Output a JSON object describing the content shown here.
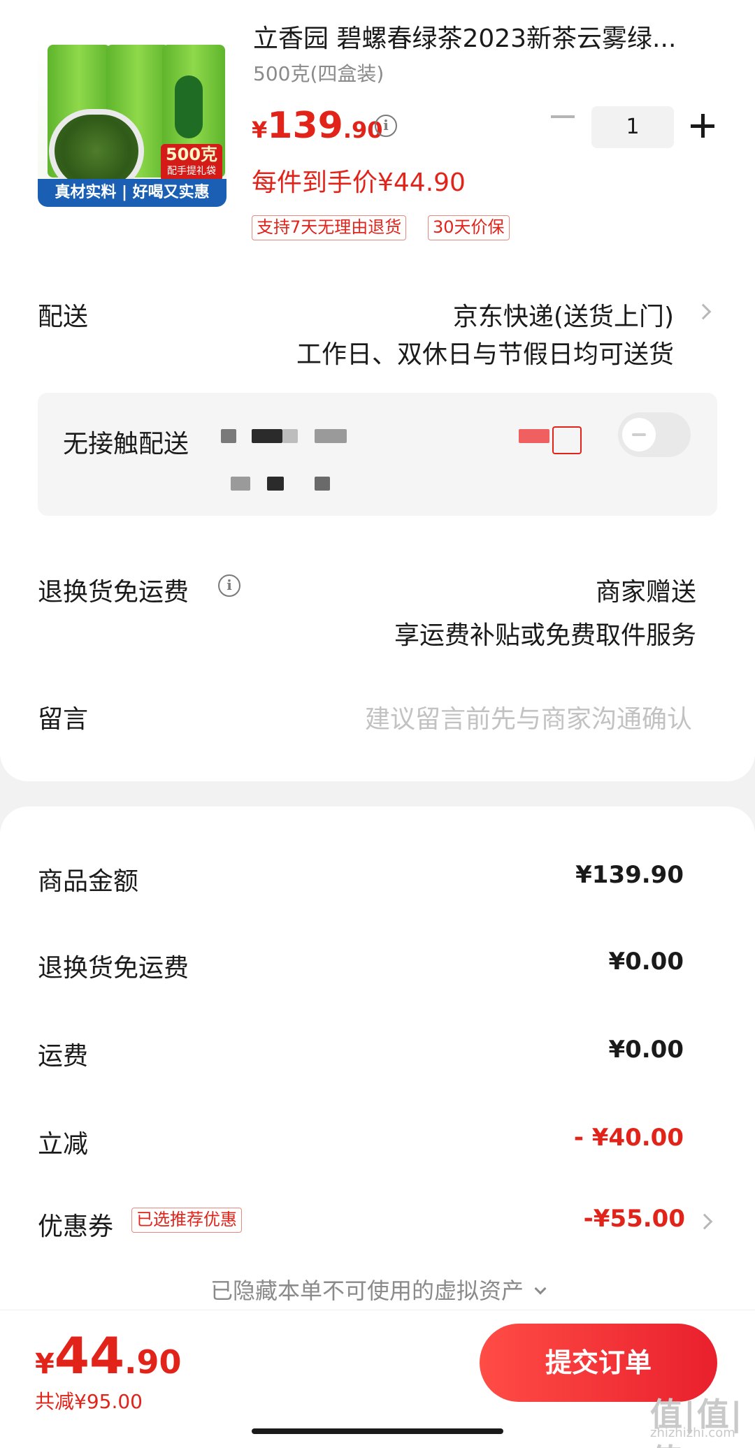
{
  "product": {
    "title": "立香园 碧螺春绿茶2023新茶云雾绿...",
    "spec": "500克(四盒装)",
    "price_symbol": "¥",
    "price_int": "139",
    "price_dec": ".90",
    "quantity": "1",
    "unit_price": "每件到手价¥44.90",
    "tags": [
      "支持7天无理由退货",
      "30天价保"
    ],
    "image_banner": "真材实料 | 好喝又实惠",
    "image_badge": "500克",
    "image_badge_sub": "配手提礼袋"
  },
  "delivery": {
    "label": "配送",
    "method": "京东快递(送货上门)",
    "note": "工作日、双休日与节假日均可送货"
  },
  "contactless": {
    "label": "无接触配送",
    "toggle_on": false
  },
  "return_shipping": {
    "label": "退换货免运费",
    "value": "商家赠送",
    "note": "享运费补贴或免费取件服务"
  },
  "message": {
    "label": "留言",
    "placeholder": "建议留言前先与商家沟通确认"
  },
  "summary": {
    "goods_label": "商品金额",
    "goods_value": "¥139.90",
    "return_label": "退换货免运费",
    "return_value": "¥0.00",
    "shipping_label": "运费",
    "shipping_value": "¥0.00",
    "discount_label": "立减",
    "discount_value": "- ¥40.00",
    "coupon_label": "优惠券",
    "coupon_tag": "已选推荐优惠",
    "coupon_value": "-¥55.00",
    "hidden_note": "已隐藏本单不可使用的虚拟资产"
  },
  "footer": {
    "total_symbol": "¥",
    "total_int": "44",
    "total_dec": ".90",
    "saved": "共减¥95.00",
    "submit_label": "提交订单",
    "watermark": "值|值|值",
    "watermark_sub": "zhizhizhi.com"
  },
  "colors": {
    "accent_red": "#e2231a",
    "submit_gradient": [
      "#ff4c45",
      "#e9202d"
    ],
    "background": "#f2f2f2"
  }
}
